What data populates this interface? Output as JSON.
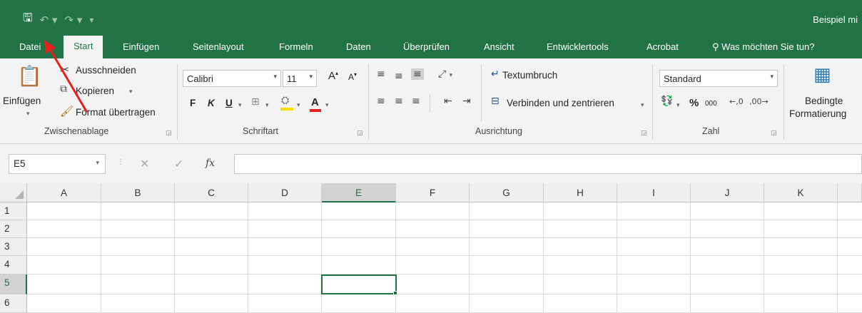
{
  "window": {
    "title": "Beispiel mi",
    "qat_icons": [
      "save-icon",
      "undo-icon",
      "redo-icon",
      "customize-icon"
    ]
  },
  "tabs": {
    "file": "Datei",
    "start": "Start",
    "insert": "Einfügen",
    "layout": "Seitenlayout",
    "formulas": "Formeln",
    "data": "Daten",
    "review": "Überprüfen",
    "view": "Ansicht",
    "developer": "Entwicklertools",
    "acrobat": "Acrobat",
    "tell_me": "Was möchten Sie tun?"
  },
  "ribbon": {
    "clipboard": {
      "paste": "Einfügen",
      "cut": "Ausschneiden",
      "copy": "Kopieren",
      "format_painter": "Format übertragen",
      "label": "Zwischenablage"
    },
    "font": {
      "family": "Calibri",
      "size": "11",
      "bold": "F",
      "italic": "K",
      "underline": "U",
      "grow": "A",
      "shrink": "A",
      "font_color": "A",
      "label": "Schriftart"
    },
    "alignment": {
      "wrap_text": "Textumbruch",
      "merge_center": "Verbinden und zentrieren",
      "label": "Ausrichtung"
    },
    "number": {
      "format": "Standard",
      "percent": "%",
      "thousands": "000",
      "label": "Zahl"
    },
    "styles": {
      "conditional_line1": "Bedingte",
      "conditional_line2": "Formatierung"
    }
  },
  "formula_bar": {
    "name_box": "E5",
    "fx": "fx",
    "formula": ""
  },
  "sheet": {
    "columns": [
      "A",
      "B",
      "C",
      "D",
      "E",
      "F",
      "G",
      "H",
      "I",
      "J",
      "K"
    ],
    "rows": [
      "1",
      "2",
      "3",
      "4",
      "5",
      "6"
    ],
    "active_cell": "E5",
    "active_column": "E",
    "active_row": "5"
  },
  "annotation": {
    "arrow_color": "#e8201c",
    "points_to": "Datei"
  },
  "colors": {
    "accent": "#217346",
    "ribbon_bg": "#f3f3f3"
  }
}
